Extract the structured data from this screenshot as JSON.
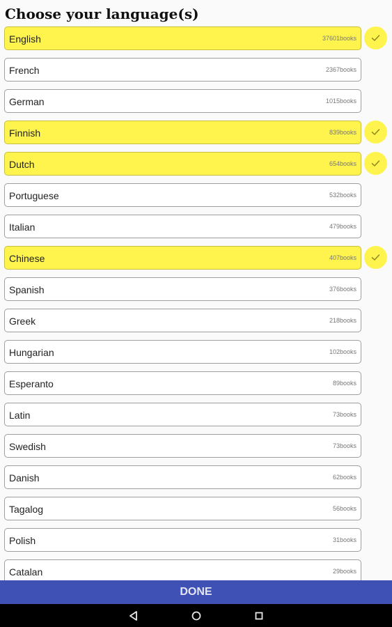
{
  "header": {
    "title": "Choose your language(s)"
  },
  "languages": [
    {
      "name": "English",
      "count": "37601books",
      "selected": true
    },
    {
      "name": "French",
      "count": "2367books",
      "selected": false
    },
    {
      "name": "German",
      "count": "1015books",
      "selected": false
    },
    {
      "name": "Finnish",
      "count": "839books",
      "selected": true
    },
    {
      "name": "Dutch",
      "count": "654books",
      "selected": true
    },
    {
      "name": "Portuguese",
      "count": "532books",
      "selected": false
    },
    {
      "name": "Italian",
      "count": "479books",
      "selected": false
    },
    {
      "name": "Chinese",
      "count": "407books",
      "selected": true
    },
    {
      "name": "Spanish",
      "count": "376books",
      "selected": false
    },
    {
      "name": "Greek",
      "count": "218books",
      "selected": false
    },
    {
      "name": "Hungarian",
      "count": "102books",
      "selected": false
    },
    {
      "name": "Esperanto",
      "count": "89books",
      "selected": false
    },
    {
      "name": "Latin",
      "count": "73books",
      "selected": false
    },
    {
      "name": "Swedish",
      "count": "73books",
      "selected": false
    },
    {
      "name": "Danish",
      "count": "62books",
      "selected": false
    },
    {
      "name": "Tagalog",
      "count": "56books",
      "selected": false
    },
    {
      "name": "Polish",
      "count": "31books",
      "selected": false
    },
    {
      "name": "Catalan",
      "count": "29books",
      "selected": false
    }
  ],
  "footer": {
    "done_label": "DONE"
  },
  "icons": {
    "selected_check": "check-icon",
    "nav_back": "back-triangle-icon",
    "nav_home": "home-circle-icon",
    "nav_recents": "recents-square-icon"
  },
  "colors": {
    "selected": "#fff34d",
    "done_bar": "#3f51b5",
    "nav_bar": "#000000"
  }
}
